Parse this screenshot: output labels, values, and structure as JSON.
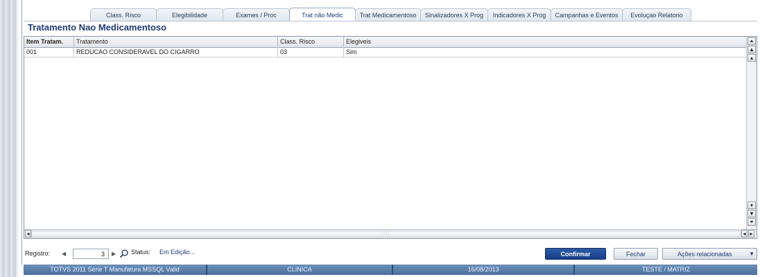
{
  "tabs": [
    {
      "label": "Class. Risco",
      "active": false
    },
    {
      "label": "Elegibilidade",
      "active": false
    },
    {
      "label": "Exames / Proc",
      "active": false
    },
    {
      "label": "Trat não Medic",
      "active": true
    },
    {
      "label": "Trat Medicamentoso",
      "active": false
    },
    {
      "label": "Sinalizadores X Prog",
      "active": false
    },
    {
      "label": "Indicadores X Prog",
      "active": false
    },
    {
      "label": "Campanhas e Eventos",
      "active": false
    },
    {
      "label": "Evoluçao Relatorio",
      "active": false
    }
  ],
  "section": {
    "title": "Tratamento Nao Medicamentoso"
  },
  "grid": {
    "columns": [
      "Item Tratam.",
      "Tratamento",
      "Class. Risco",
      "Elegiveis"
    ],
    "rows": [
      [
        "001",
        "REDUCAO CONSIDERAVEL DO CIGARRO",
        "03",
        "Sim"
      ]
    ]
  },
  "footer": {
    "registro_label": "Registro:",
    "registro_value": "3",
    "status_label": "Status:",
    "status_value": "Em Edição...",
    "confirm_label": "Confirmar",
    "close_label": "Fechar",
    "actions_label": "Ações relacionadas"
  },
  "statusbar": {
    "system": "TOTVS 2011 Série T Manufatura MSSQL Valid",
    "module": "CLINICA",
    "date": "16/08/2013",
    "company": "TESTE / MATRIZ"
  }
}
